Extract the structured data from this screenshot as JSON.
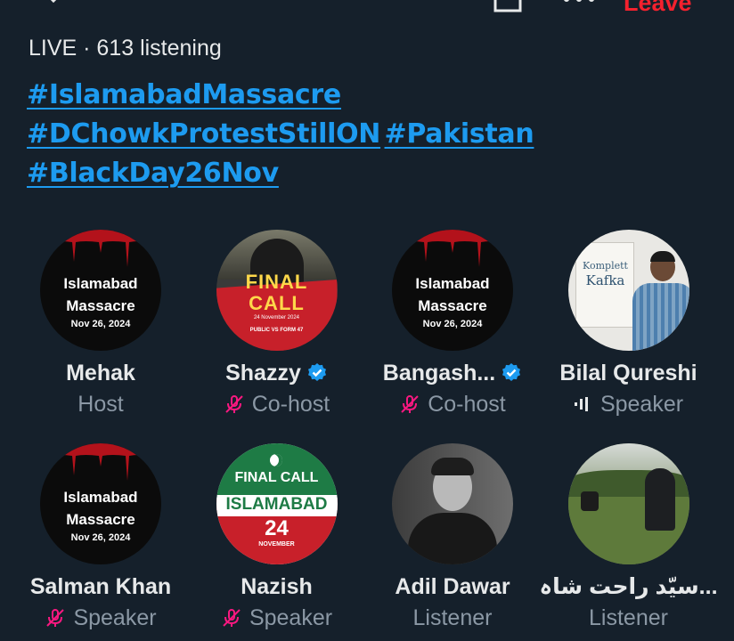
{
  "header": {
    "leave_label": "Leave",
    "live_status": "LIVE · 613 listening"
  },
  "title_hashtags": [
    [
      "#IslamabadMassacre"
    ],
    [
      "#DChowkProtestStillON",
      "#Pakistan"
    ],
    [
      "#BlackDay26Nov"
    ]
  ],
  "participants": [
    {
      "name": "Mehak",
      "role": "Host",
      "verified": false,
      "mic": "none",
      "avatar": {
        "kind": "massacre",
        "line1": "Islamabad",
        "line2": "Massacre",
        "line3": "Nov 26, 2024"
      }
    },
    {
      "name": "Shazzy",
      "role": "Co-host",
      "verified": true,
      "mic": "muted",
      "avatar": {
        "kind": "finalcall",
        "line1": "FINAL",
        "line2": "CALL",
        "line3": "24 November 2024",
        "line4": "PUBLIC  VS  FORM 47"
      }
    },
    {
      "name": "Bangash...",
      "role": "Co-host",
      "verified": true,
      "mic": "muted",
      "avatar": {
        "kind": "massacre",
        "line1": "Islamabad",
        "line2": "Massacre",
        "line3": "Nov 26, 2024"
      }
    },
    {
      "name": "Bilal Qureshi",
      "role": "Speaker",
      "verified": false,
      "mic": "speaking",
      "avatar": {
        "kind": "kafka",
        "line1": "Komplett",
        "line2": "Kafka"
      }
    },
    {
      "name": "Salman Khan",
      "role": "Speaker",
      "verified": false,
      "mic": "muted",
      "avatar": {
        "kind": "massacre",
        "line1": "Islamabad",
        "line2": "Massacre",
        "line3": "Nov 26, 2024"
      }
    },
    {
      "name": "Nazish",
      "role": "Speaker",
      "verified": false,
      "mic": "muted",
      "avatar": {
        "kind": "islamabad",
        "line1": "FINAL CALL",
        "line2": "ISLAMABAD",
        "line3": "24",
        "line4": "NOVEMBER"
      }
    },
    {
      "name": "Adil Dawar",
      "role": "Listener",
      "verified": false,
      "mic": "none",
      "avatar": {
        "kind": "adil"
      }
    },
    {
      "name": "سیّد راحت شاہ...",
      "role": "Listener",
      "verified": false,
      "mic": "none",
      "avatar": {
        "kind": "rahat"
      }
    }
  ],
  "colors": {
    "background": "#15202b",
    "hashtag": "#1d9bf0",
    "leave": "#f4212e",
    "verified": "#1d9bf0",
    "muted_icon": "#f91880",
    "secondary_text": "#8b98a5"
  },
  "icons": {
    "collapse": "chevron-down-icon",
    "share": "share-icon",
    "more": "more-icon",
    "verified": "verified-badge-icon",
    "muted": "mic-off-icon",
    "speaking": "audio-bars-icon"
  }
}
